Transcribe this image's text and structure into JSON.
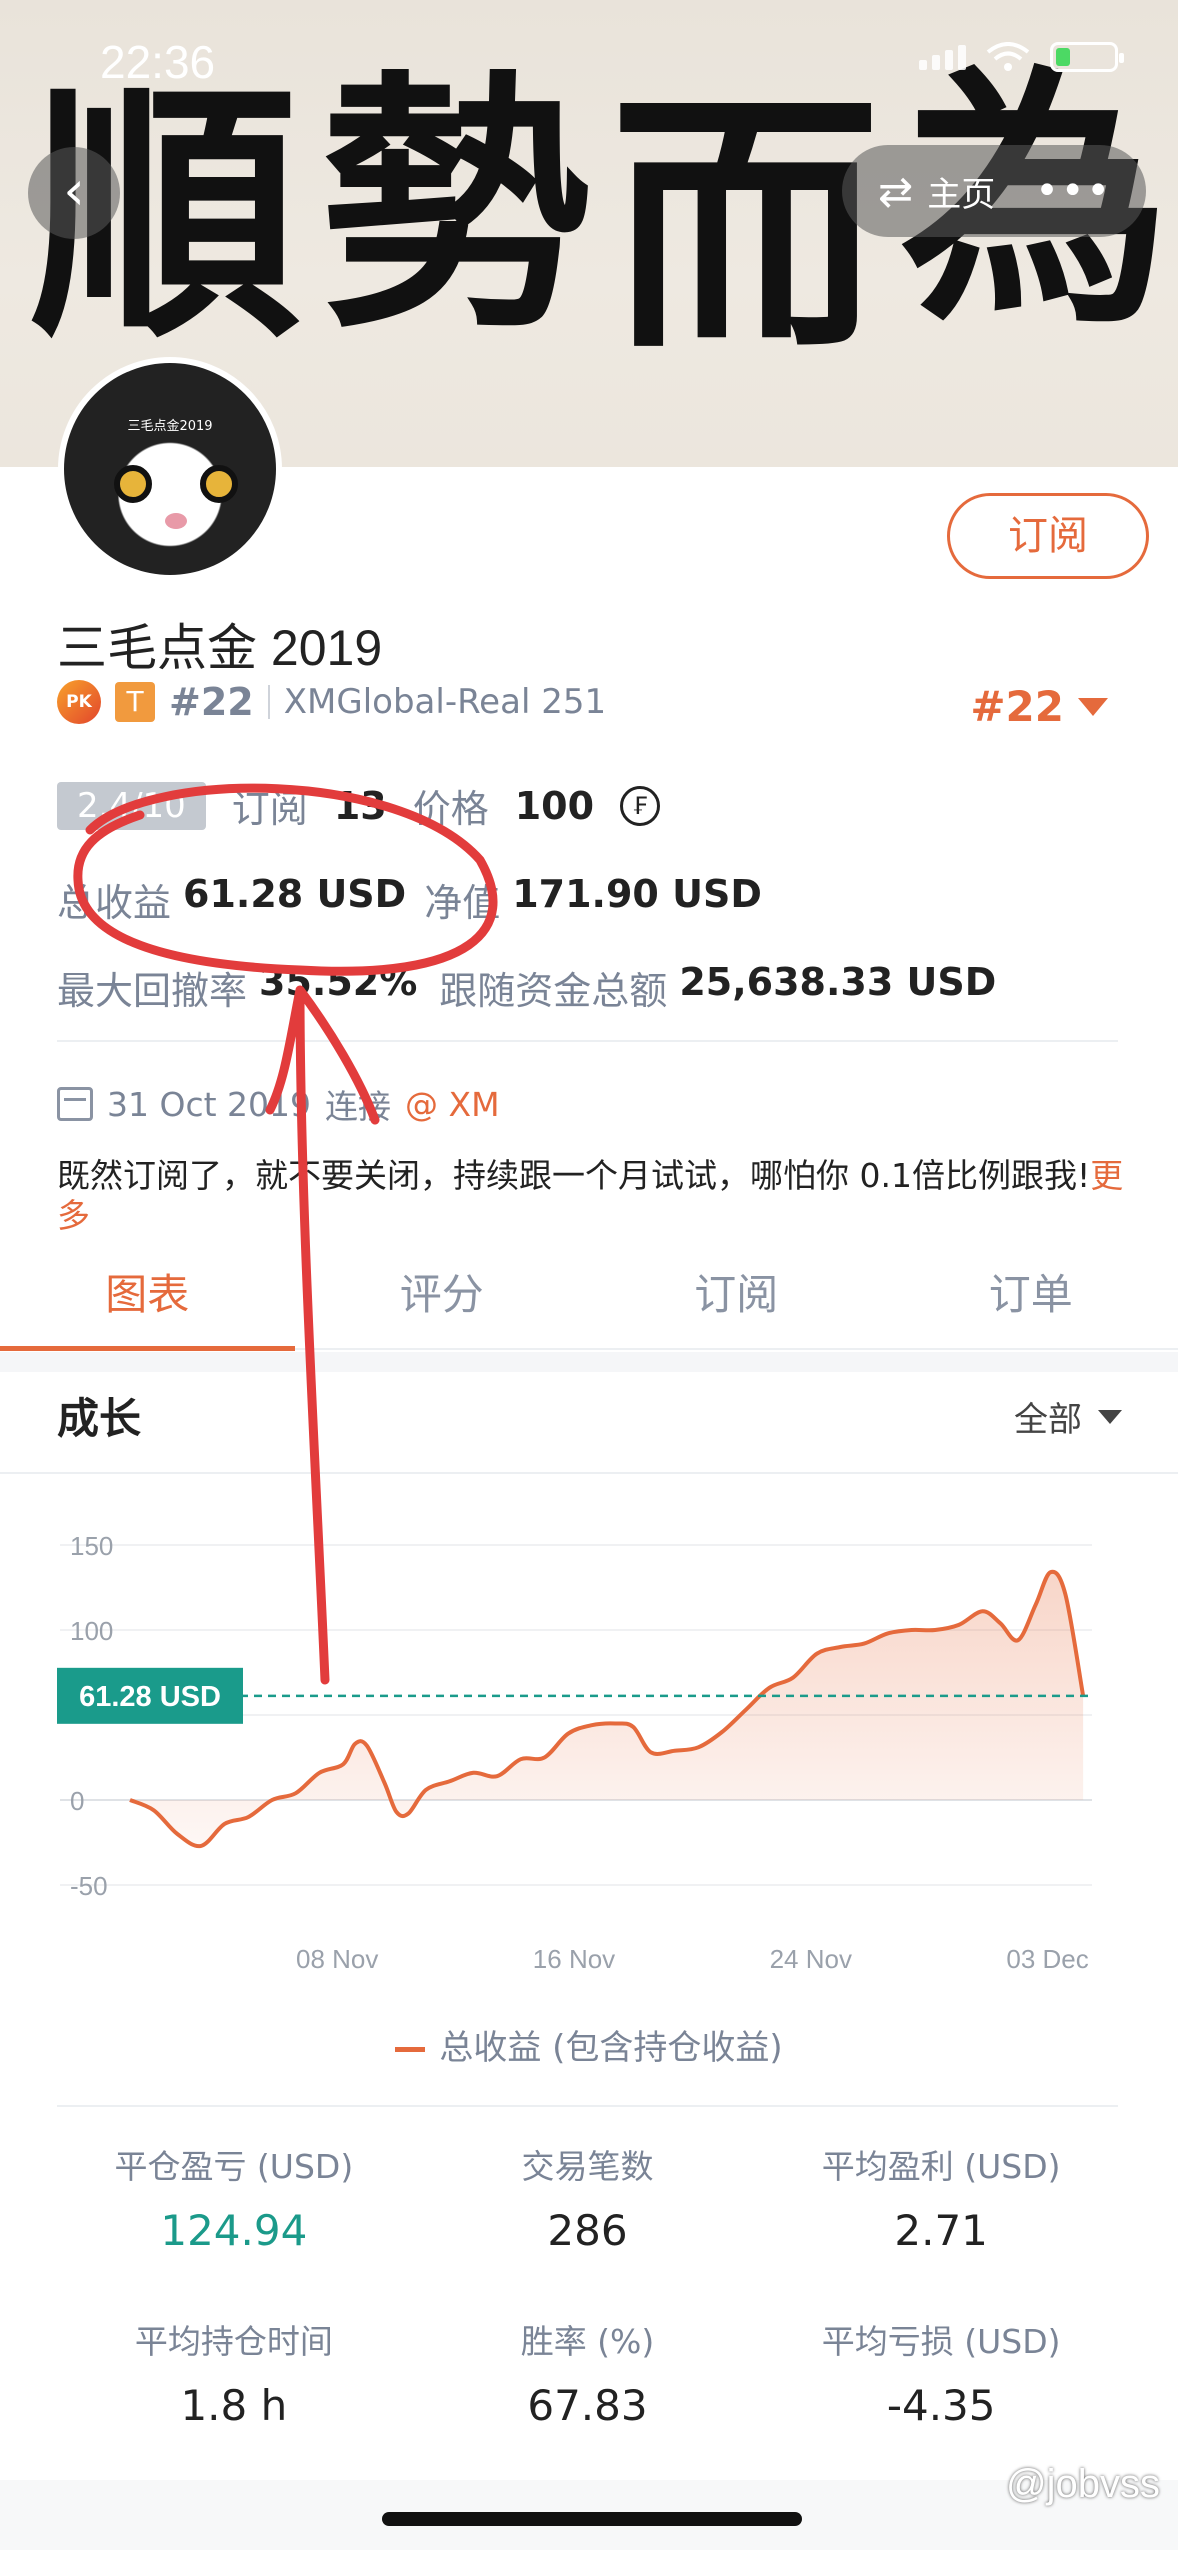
{
  "status_bar": {
    "time": "22:36"
  },
  "banner": {
    "calligraphy": [
      "順",
      "勢",
      "而",
      "為"
    ]
  },
  "header": {
    "back_glyph": "‹",
    "swap_glyph": "⇄",
    "home_label": "主页",
    "more_glyph": "•••"
  },
  "profile": {
    "avatar_caption": "三毛点金2019",
    "subscribe_label": "订阅",
    "name": "三毛点金 2019",
    "pk_badge": "PK",
    "t_badge": "T",
    "rank": "#22",
    "account": "XMGlobal-Real 251",
    "rank_right": "#22"
  },
  "metrics": {
    "score": "2.4/10",
    "subscribe_label": "订阅",
    "subscribe_count": "13",
    "price_label": "价格",
    "price_value": "100",
    "coin_glyph": "₣",
    "total_profit_label": "总收益",
    "total_profit_value": "61.28 USD",
    "net_label": "净值",
    "net_value": "171.90 USD",
    "drawdown_label": "最大回撤率",
    "drawdown_value": "35.52%",
    "follow_label": "跟随资金总额",
    "follow_value": "25,638.33 USD"
  },
  "meta": {
    "date": "31 Oct 2019",
    "connect": "连接",
    "broker": "@ XM"
  },
  "description": {
    "text": "既然订阅了，就不要关闭，持续跟一个月试试，哪怕你 0.1倍比例跟我!",
    "more": "更多"
  },
  "tabs": [
    {
      "label": "图表",
      "active": true
    },
    {
      "label": "评分",
      "active": false
    },
    {
      "label": "订阅",
      "active": false
    },
    {
      "label": "订单",
      "active": false
    }
  ],
  "growth": {
    "title": "成长",
    "filter": "全部"
  },
  "chart_data": {
    "type": "area",
    "y_ticks": [
      150,
      100,
      0,
      -50
    ],
    "ylim": [
      -50,
      150
    ],
    "x_ticks": [
      "08 Nov",
      "16 Nov",
      "24 Nov",
      "03 Dec"
    ],
    "x_tick_positions": [
      7,
      15,
      23,
      31
    ],
    "xlim": [
      0,
      32.5
    ],
    "current_value_label": "61.28 USD",
    "current_value": 61.28,
    "series": [
      {
        "name": "总收益 (包含持仓收益)",
        "color": "#e56a3c",
        "points": [
          [
            0.0,
            0
          ],
          [
            0.8,
            -6
          ],
          [
            1.6,
            -20
          ],
          [
            2.4,
            -27
          ],
          [
            3.2,
            -14
          ],
          [
            4.0,
            -10
          ],
          [
            4.8,
            0
          ],
          [
            5.6,
            4
          ],
          [
            6.4,
            16
          ],
          [
            7.2,
            21
          ],
          [
            7.6,
            33
          ],
          [
            8.0,
            32
          ],
          [
            8.6,
            10
          ],
          [
            9.0,
            -7
          ],
          [
            9.4,
            -8
          ],
          [
            10.0,
            6
          ],
          [
            10.8,
            11
          ],
          [
            11.6,
            16
          ],
          [
            12.4,
            14
          ],
          [
            13.2,
            24
          ],
          [
            14.0,
            25
          ],
          [
            14.8,
            39
          ],
          [
            15.6,
            44
          ],
          [
            16.4,
            45
          ],
          [
            17.0,
            43
          ],
          [
            17.6,
            28
          ],
          [
            18.4,
            29
          ],
          [
            19.2,
            31
          ],
          [
            20.0,
            40
          ],
          [
            20.8,
            53
          ],
          [
            21.6,
            66
          ],
          [
            22.4,
            72
          ],
          [
            23.2,
            86
          ],
          [
            24.0,
            90
          ],
          [
            24.8,
            92
          ],
          [
            25.6,
            98
          ],
          [
            26.4,
            100
          ],
          [
            27.2,
            100
          ],
          [
            28.0,
            103
          ],
          [
            28.8,
            111
          ],
          [
            29.4,
            104
          ],
          [
            30.0,
            94
          ],
          [
            30.6,
            115
          ],
          [
            31.1,
            134
          ],
          [
            31.6,
            121
          ],
          [
            32.2,
            61.28
          ]
        ]
      }
    ],
    "legend": "总收益 (包含持仓收益)"
  },
  "stats": [
    {
      "label": "平仓盈亏 (USD)",
      "value": "124.94",
      "highlight": true
    },
    {
      "label": "交易笔数",
      "value": "286",
      "highlight": false
    },
    {
      "label": "平均盈利 (USD)",
      "value": "2.71",
      "highlight": false
    },
    {
      "label": "平均持仓时间",
      "value": "1.8 h",
      "highlight": false
    },
    {
      "label": "胜率 (%)",
      "value": "67.83",
      "highlight": false
    },
    {
      "label": "平均亏损 (USD)",
      "value": "-4.35",
      "highlight": false
    }
  ],
  "watermark": "@jobvss"
}
